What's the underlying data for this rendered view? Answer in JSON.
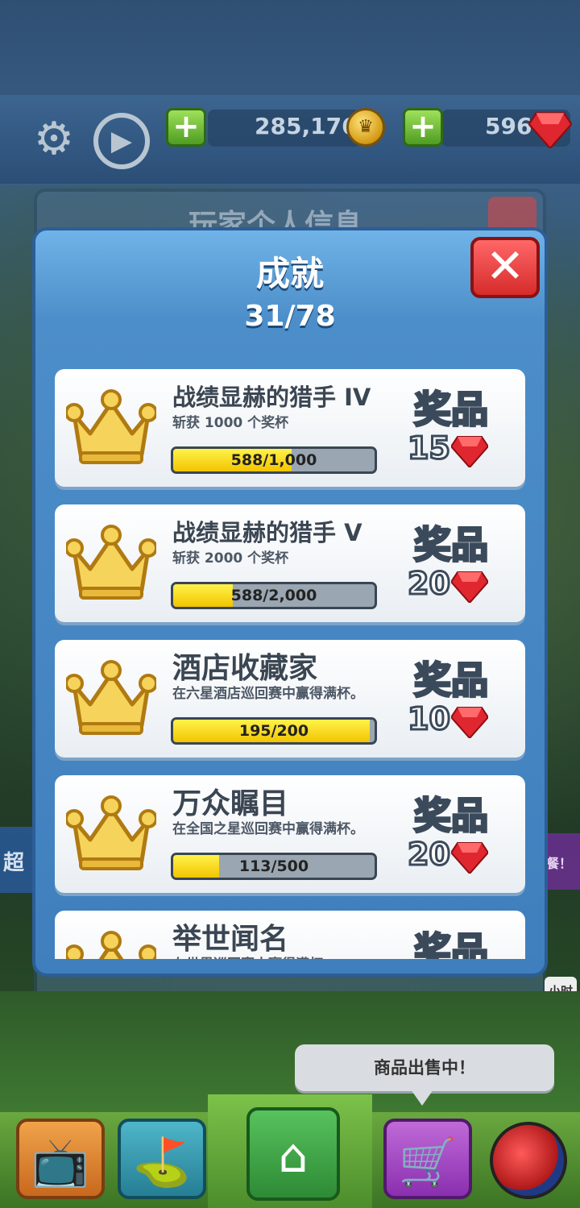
{
  "hud": {
    "coins": "285,176",
    "gems": "596",
    "coin_icon": "crown-coin-icon",
    "gem_icon": "ruby-gem-icon",
    "plus_symbol": "+"
  },
  "background": {
    "panel_title": "玩家个人信息",
    "left_side_label": "超",
    "right_side_label": "餐！",
    "timer_chip": "小时"
  },
  "modal": {
    "title": "成就",
    "progress": "31/78",
    "close_symbol": "✕"
  },
  "achievements": [
    {
      "title": "战绩显赫的猎手 IV",
      "desc": "斩获 1000 个奖杯",
      "progress_text": "588/1,000",
      "progress": 0.588,
      "prize_label": "奖品",
      "prize": "15"
    },
    {
      "title": "战绩显赫的猎手 V",
      "desc": "斩获 2000 个奖杯",
      "progress_text": "588/2,000",
      "progress": 0.294,
      "prize_label": "奖品",
      "prize": "20"
    },
    {
      "title": "酒店收藏家",
      "desc": "在六星酒店巡回赛中赢得满杯。",
      "progress_text": "195/200",
      "progress": 0.975,
      "prize_label": "奖品",
      "prize": "10"
    },
    {
      "title": "万众瞩目",
      "desc": "在全国之星巡回赛中赢得满杯。",
      "progress_text": "113/500",
      "progress": 0.226,
      "prize_label": "奖品",
      "prize": "20"
    },
    {
      "title": "举世闻名",
      "desc": "在世界巡回赛中赢得满杯。",
      "progress_text": "",
      "progress": 0,
      "prize_label": "奖品",
      "prize": ""
    }
  ],
  "tooltip": "商品出售中！",
  "colors": {
    "accent_blue": "#3f7fbd",
    "close_red": "#d62b2b",
    "bar_yellow": "#f2c400",
    "gem_red": "#e0262f"
  }
}
